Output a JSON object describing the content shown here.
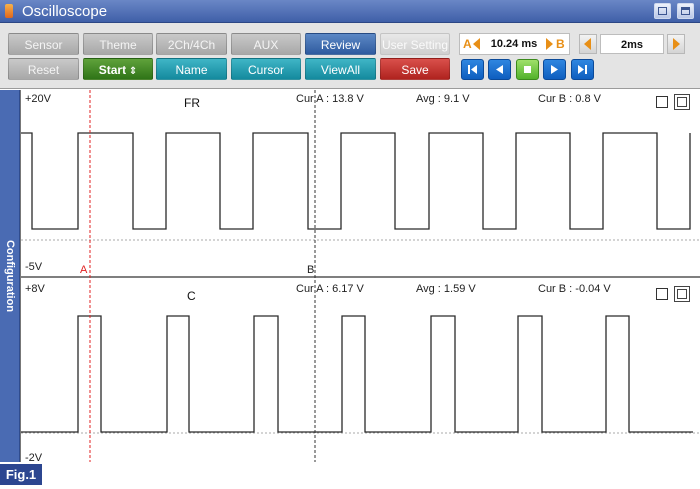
{
  "window": {
    "title": "Oscilloscope"
  },
  "toolbar": {
    "row1": [
      {
        "label": "Sensor",
        "style": "gray"
      },
      {
        "label": "Theme",
        "style": "gray"
      },
      {
        "label": "2Ch/4Ch",
        "style": "gray"
      },
      {
        "label": "AUX",
        "style": "gray"
      },
      {
        "label": "Review",
        "style": "blue"
      },
      {
        "label": "User Setting",
        "style": "light"
      }
    ],
    "row2": [
      {
        "label": "Reset",
        "style": "gray"
      },
      {
        "label": "Start",
        "style": "green"
      },
      {
        "label": "Name",
        "style": "teal"
      },
      {
        "label": "Cursor",
        "style": "teal"
      },
      {
        "label": "ViewAll",
        "style": "teal"
      },
      {
        "label": "Save",
        "style": "red"
      }
    ],
    "cursor_range": {
      "left_letter": "A",
      "value": "10.24 ms",
      "right_letter": "B"
    },
    "time_div": {
      "value": "2ms"
    }
  },
  "side_panel": {
    "label": "Configuration"
  },
  "channels": [
    {
      "name": "FR",
      "y_max": "+20V",
      "y_min": "-5V",
      "cur_a": "Cur A : 13.8 V",
      "avg": "Avg : 9.1 V",
      "cur_b": "Cur B : 0.8 V"
    },
    {
      "name": "C",
      "y_max": "+8V",
      "y_min": "-2V",
      "cur_a": "Cur A : 6.17 V",
      "avg": "Avg : 1.59 V",
      "cur_b": "Cur B : -0.04 V"
    }
  ],
  "cursors": {
    "a_label": "A",
    "b_label": "B"
  },
  "figure_label": "Fig.1",
  "colors": {
    "cursor_a": "#e02020",
    "trace": "#2a2a2a",
    "accent": "#e88f16",
    "panel": "#4a6bb3"
  }
}
